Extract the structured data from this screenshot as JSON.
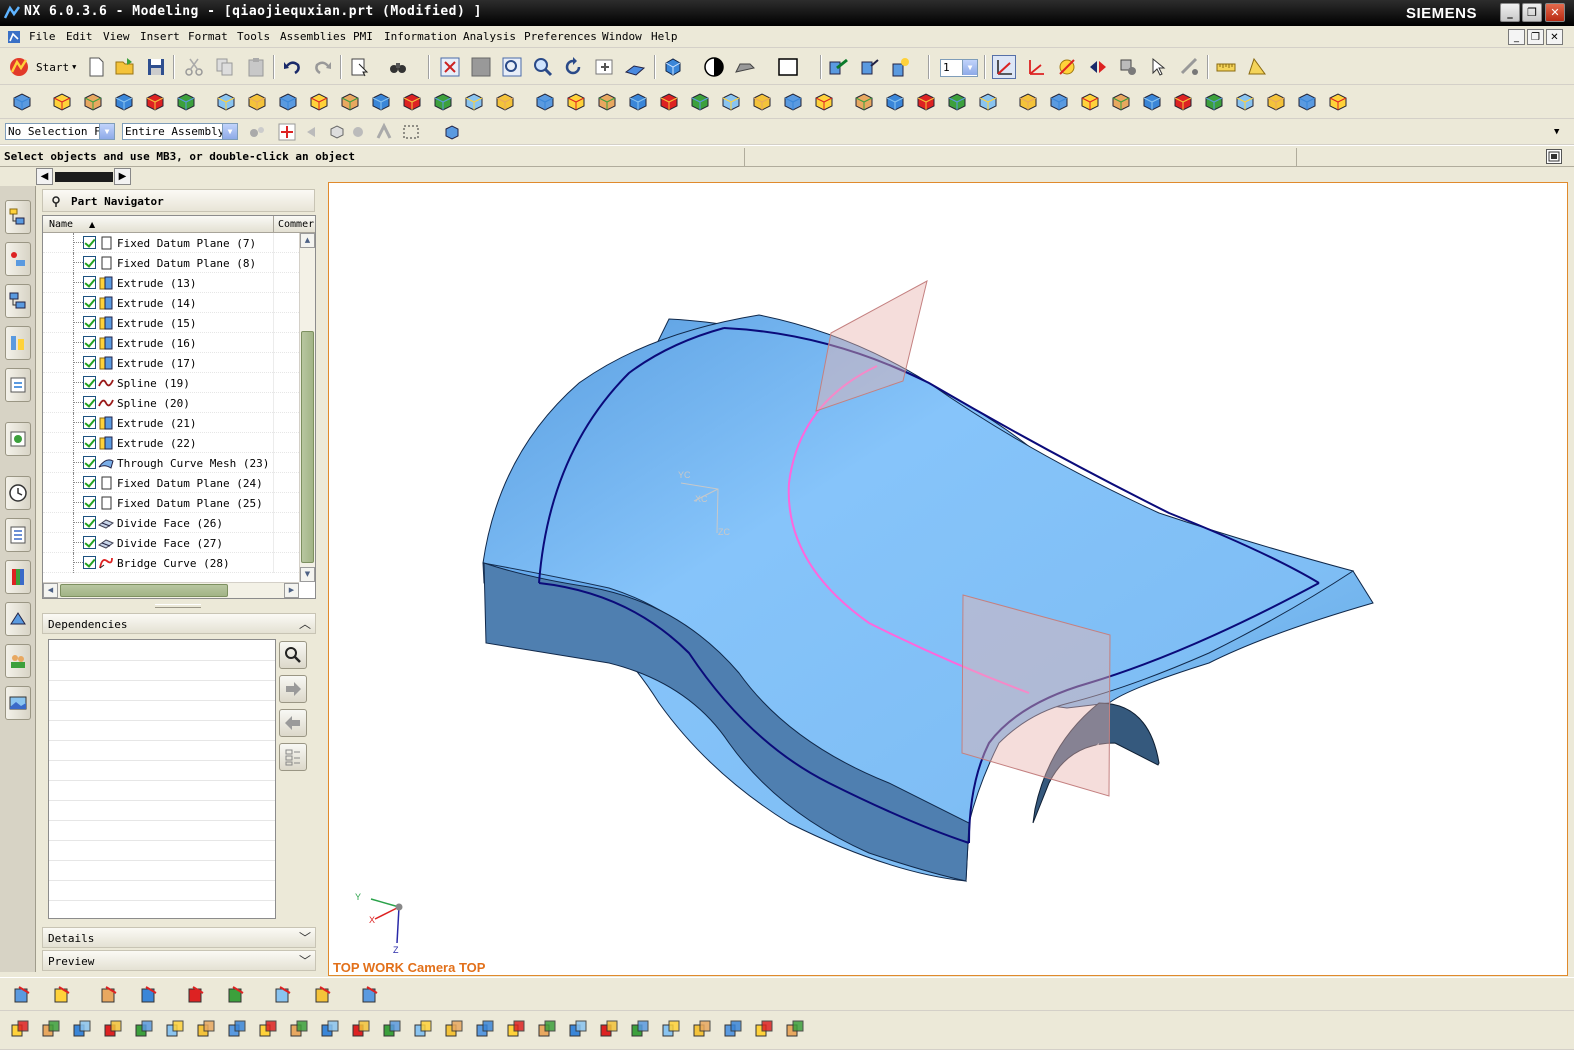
{
  "window": {
    "title": "NX 6.0.3.6 - Modeling - [qiaojiequxian.prt (Modified) ]",
    "brand": "SIEMENS",
    "controls": [
      "_",
      "❐",
      "✕"
    ]
  },
  "menubar": {
    "items": [
      "File",
      "Edit",
      "View",
      "Insert",
      "Format",
      "Tools",
      "Assemblies",
      "PMI",
      "Information",
      "Analysis",
      "Preferences",
      "Window",
      "Help"
    ],
    "mdi_controls": [
      "_",
      "❐",
      "✕"
    ]
  },
  "standard_toolbar": {
    "start_label": "Start"
  },
  "selection_bar": {
    "filter_value": "No Selection Fi",
    "scope_value": "Entire Assembly",
    "layer_value": "1"
  },
  "prompt": {
    "text": "Select objects and use MB3, or double-click an object"
  },
  "part_navigator": {
    "title": "Part Navigator",
    "columns": [
      "Name",
      "Commer"
    ],
    "items": [
      {
        "label": "Fixed Datum Plane  (7)",
        "icon": "datum-plane-icon"
      },
      {
        "label": "Fixed Datum Plane  (8)",
        "icon": "datum-plane-icon"
      },
      {
        "label": "Extrude  (13)",
        "icon": "extrude-icon"
      },
      {
        "label": "Extrude  (14)",
        "icon": "extrude-icon"
      },
      {
        "label": "Extrude  (15)",
        "icon": "extrude-icon"
      },
      {
        "label": "Extrude  (16)",
        "icon": "extrude-icon"
      },
      {
        "label": "Extrude  (17)",
        "icon": "extrude-icon"
      },
      {
        "label": "Spline  (19)",
        "icon": "spline-icon"
      },
      {
        "label": "Spline  (20)",
        "icon": "spline-icon"
      },
      {
        "label": "Extrude  (21)",
        "icon": "extrude-icon"
      },
      {
        "label": "Extrude  (22)",
        "icon": "extrude-icon"
      },
      {
        "label": "Through Curve Mesh  (23)",
        "icon": "curve-mesh-icon"
      },
      {
        "label": "Fixed Datum Plane  (24)",
        "icon": "datum-plane-icon"
      },
      {
        "label": "Fixed Datum Plane  (25)",
        "icon": "datum-plane-icon"
      },
      {
        "label": "Divide Face  (26)",
        "icon": "divide-face-icon"
      },
      {
        "label": "Divide Face  (27)",
        "icon": "divide-face-icon"
      },
      {
        "label": "Bridge Curve  (28)",
        "icon": "bridge-curve-icon"
      }
    ],
    "panels": {
      "dependencies": "Dependencies",
      "details": "Details",
      "preview": "Preview"
    }
  },
  "graphics": {
    "view_label": "TOP WORK Camera TOP",
    "wcs_labels": {
      "yc": "YC",
      "xc": "XC",
      "zc": "ZC"
    },
    "triad_labels": {
      "y": "Y",
      "x": "X",
      "z": "Z"
    },
    "colors": {
      "surface": "#7fbef5",
      "surface_dark": "#2f4f6f",
      "edge": "#0b0b7a",
      "bridge_curve": "#ff66dd",
      "datum_plane": "#e8a8a0",
      "view_label": "#e2701a"
    }
  }
}
